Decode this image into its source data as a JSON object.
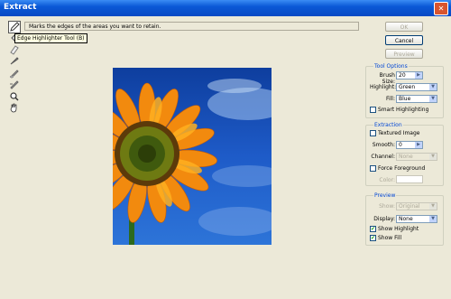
{
  "window": {
    "title": "Extract",
    "close": "✕"
  },
  "toolbar": {
    "tools": [
      {
        "name": "edge-highlighter-tool",
        "icon": "pencil-highlighter-icon",
        "active": true
      },
      {
        "name": "fill-tool",
        "icon": "paint-bucket-icon"
      },
      {
        "name": "eraser-tool",
        "icon": "eraser-icon"
      },
      {
        "name": "eyedropper-tool",
        "icon": "eyedropper-icon"
      },
      {
        "name": "cleanup-tool",
        "icon": "cleanup-icon"
      },
      {
        "name": "edge-touchup-tool",
        "icon": "touchup-icon"
      },
      {
        "name": "zoom-tool",
        "icon": "magnifier-icon"
      },
      {
        "name": "hand-tool",
        "icon": "hand-icon"
      }
    ]
  },
  "hint": "Marks the edges of the areas you want to retain.",
  "tooltip": "Edge Highlighter Tool (B)",
  "buttons": {
    "ok": "OK",
    "cancel": "Cancel",
    "preview": "Preview"
  },
  "tool_options": {
    "legend": "Tool Options",
    "brush_size_label": "Brush Size:",
    "brush_size": "20",
    "highlight_label": "Highlight:",
    "highlight": "Green",
    "fill_label": "Fill:",
    "fill": "Blue",
    "smart_highlighting": "Smart Highlighting"
  },
  "extraction": {
    "legend": "Extraction",
    "textured_image": "Textured Image",
    "smooth_label": "Smooth:",
    "smooth": "0",
    "channel_label": "Channel:",
    "channel": "None",
    "force_foreground": "Force Foreground",
    "color_label": "Color:"
  },
  "preview_group": {
    "legend": "Preview",
    "show_label": "Show:",
    "show": "Original",
    "display_label": "Display:",
    "display": "None",
    "show_highlight": "Show Highlight",
    "show_fill": "Show Fill"
  },
  "colors": {
    "title_bar": "#0A58D6",
    "highlight_green": "#21A121",
    "sky_blue": "#1E5BC8",
    "petal_orange": "#F28A0E"
  }
}
